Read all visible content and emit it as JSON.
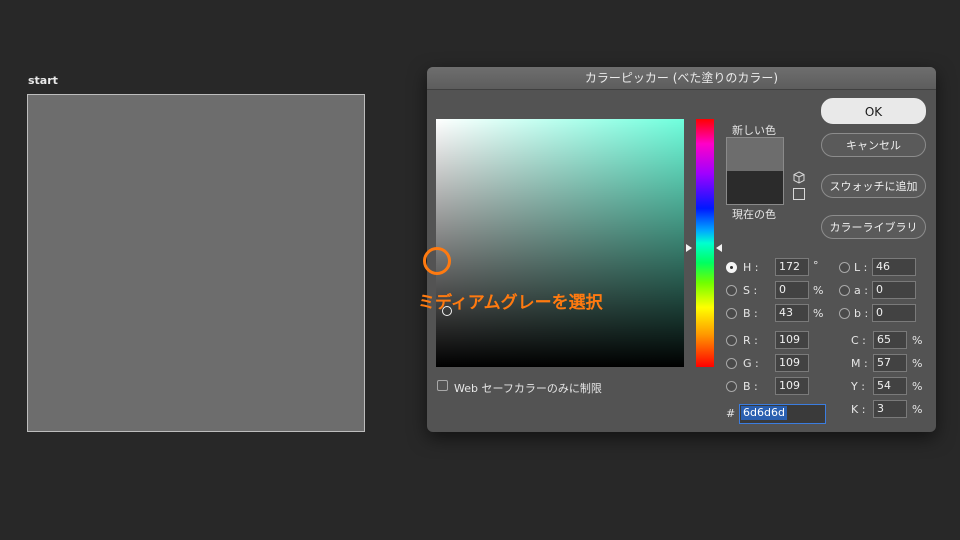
{
  "canvas": {
    "label": "start",
    "fill_color": "#6d6d6d"
  },
  "dialog": {
    "title": "カラーピッカー (べた塗りのカラー)",
    "new_color_label": "新しい色",
    "current_color_label": "現在の色",
    "new_color": "#6d6d6d",
    "current_color": "#2b2b2b",
    "buttons": {
      "ok": "OK",
      "cancel": "キャンセル",
      "add_swatch": "スウォッチに追加",
      "color_library": "カラーライブラリ"
    },
    "hsb": {
      "h": {
        "label": "H :",
        "value": "172",
        "unit": "°"
      },
      "s": {
        "label": "S :",
        "value": "0",
        "unit": "%"
      },
      "b": {
        "label": "B :",
        "value": "43",
        "unit": "%"
      }
    },
    "rgb": {
      "r": {
        "label": "R :",
        "value": "109"
      },
      "g": {
        "label": "G :",
        "value": "109"
      },
      "b": {
        "label": "B :",
        "value": "109"
      }
    },
    "lab": {
      "l": {
        "label": "L :",
        "value": "46"
      },
      "a": {
        "label": "a :",
        "value": "0"
      },
      "b": {
        "label": "b :",
        "value": "0"
      }
    },
    "cmyk": {
      "c": {
        "label": "C :",
        "value": "65",
        "unit": "%"
      },
      "m": {
        "label": "M :",
        "value": "57",
        "unit": "%"
      },
      "y": {
        "label": "Y :",
        "value": "54",
        "unit": "%"
      },
      "k": {
        "label": "K :",
        "value": "3",
        "unit": "%"
      }
    },
    "hex": {
      "label": "#",
      "value": "6d6d6d"
    },
    "web_only_label": "Web セーフカラーのみに制限",
    "selected_mode": "H"
  },
  "annotation": {
    "text": "ミディアムグレーを選択",
    "color": "#ff7a10"
  }
}
